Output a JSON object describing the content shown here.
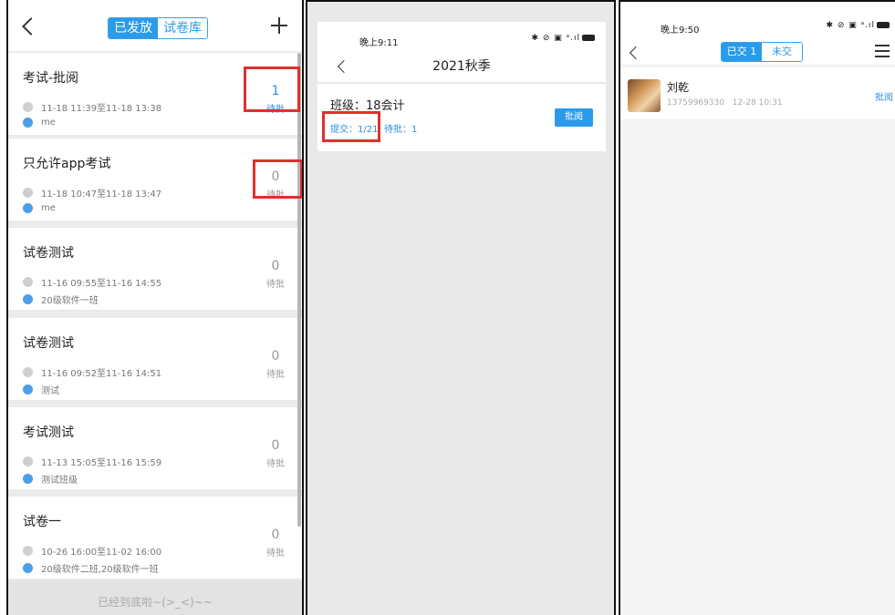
{
  "panel1": {
    "tabs": [
      "已发放",
      "试卷库"
    ],
    "exams": [
      {
        "title": "考试-批阅",
        "time": "11-18 11:39至11-18 13:38",
        "target": "me",
        "pending": "1",
        "pending_label": "待批"
      },
      {
        "title": "只允许app考试",
        "time": "11-18 10:47至11-18 13:47",
        "target": "me",
        "pending": "0",
        "pending_label": "待批"
      },
      {
        "title": "试卷测试",
        "time": "11-16 09:55至11-16 14:55",
        "target": "20级软件一班",
        "pending": "0",
        "pending_label": "待批"
      },
      {
        "title": "试卷测试",
        "time": "11-16 09:52至11-16 14:51",
        "target": "测试",
        "pending": "0",
        "pending_label": "待批"
      },
      {
        "title": "考试测试",
        "time": "11-13 15:05至11-16 15:59",
        "target": "测试班级",
        "pending": "0",
        "pending_label": "待批"
      },
      {
        "title": "试卷一",
        "time": "10-26 16:00至11-02 16:00",
        "target": "20级软件二班,20级软件一班",
        "pending": "0",
        "pending_label": "待批"
      }
    ],
    "footer": "已经到底啦~(>_<)~~"
  },
  "panel2": {
    "time": "晚上9:11",
    "title": "2021秋季",
    "class_label": "班级：18会计",
    "submitted": "提交：1/21",
    "pending": "待批：1",
    "review_button": "批阅"
  },
  "panel3": {
    "time": "晚上9:50",
    "tabs": [
      "已交 1",
      "未交"
    ],
    "student": {
      "name": "刘乾",
      "phone": "13759969330",
      "submit_time": "12-28 10:31"
    },
    "review_link": "批阅"
  },
  "colors": {
    "accent": "#2a9bea",
    "highlight_box": "#e0302b"
  }
}
